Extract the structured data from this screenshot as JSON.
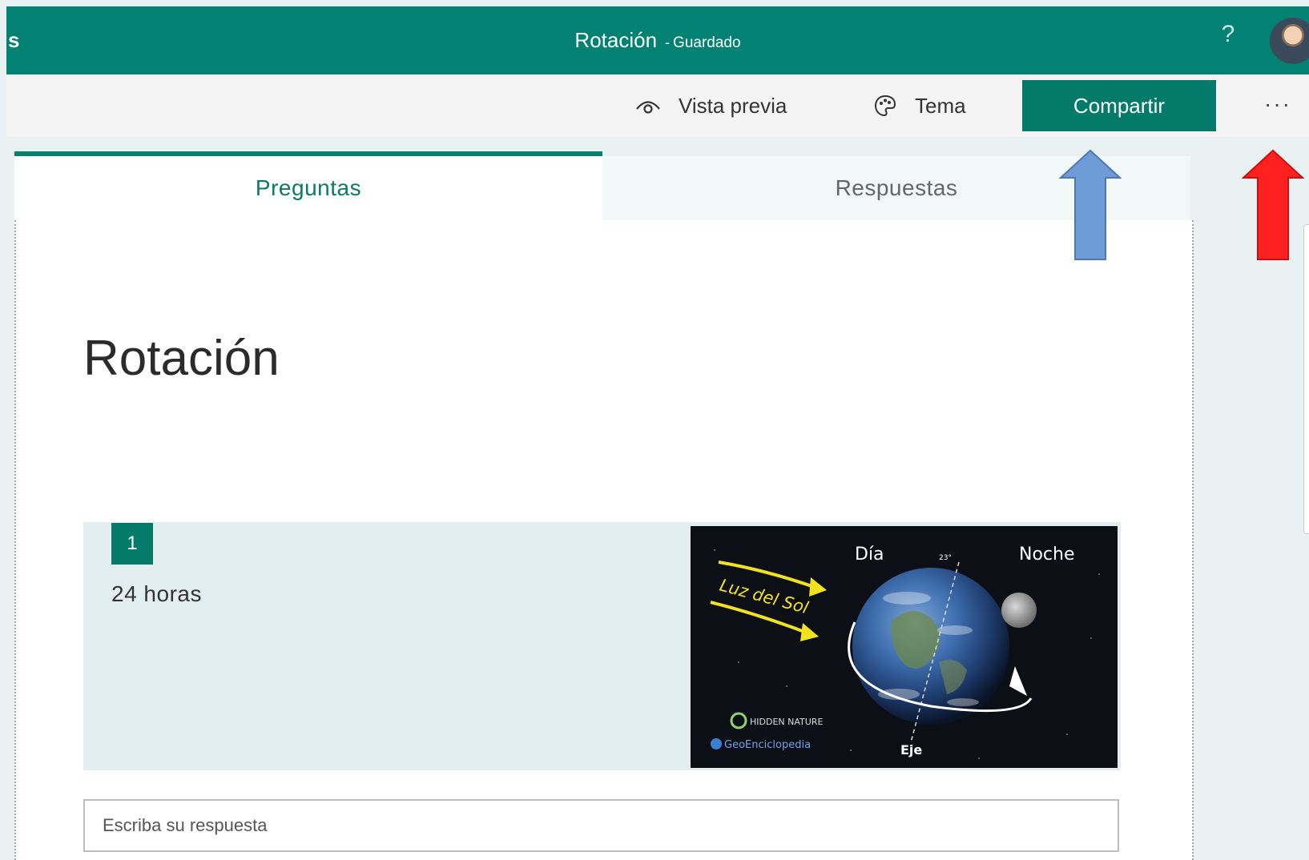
{
  "app": {
    "name_fragment": "s"
  },
  "header": {
    "title": "Rotación",
    "separator": "-",
    "status": "Guardado",
    "help_label": "?"
  },
  "commands": {
    "preview_label": "Vista previa",
    "theme_label": "Tema",
    "share_label": "Compartir",
    "more_label": "···"
  },
  "tabs": [
    {
      "label": "Preguntas",
      "active": true
    },
    {
      "label": "Respuestas",
      "active": false
    }
  ],
  "form": {
    "title": "Rotación",
    "questions": [
      {
        "number": "1",
        "text": "24 horas",
        "image": {
          "labels": {
            "day": "Día",
            "night": "Noche",
            "sunlight": "Luz del Sol",
            "axis": "Eje",
            "tilt": "23°",
            "logo1": "HIDDEN NATURE",
            "logo2": "GeoEnciclopedia"
          }
        },
        "answer_placeholder": "Escriba su respuesta"
      }
    ]
  },
  "colors": {
    "brand": "#038172",
    "share_button": "#047a6b",
    "annotation_blue": "#6f9bd6",
    "annotation_red": "#ff2020"
  },
  "icons": {
    "preview": "eye-icon",
    "theme": "palette-icon",
    "help": "help-icon",
    "more": "more-icon"
  }
}
